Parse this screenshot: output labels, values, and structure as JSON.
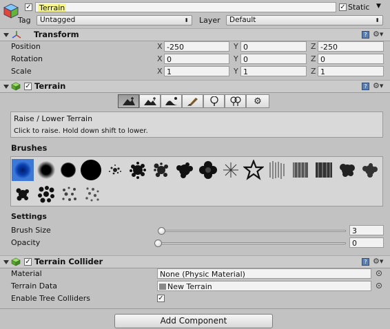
{
  "object": {
    "name": "Terrain",
    "active_checked": true,
    "static_label": "Static",
    "static_checked": true,
    "tag_label": "Tag",
    "tag_value": "Untagged",
    "layer_label": "Layer",
    "layer_value": "Default"
  },
  "transform": {
    "title": "Transform",
    "rows": [
      {
        "label": "Position",
        "x": "-250",
        "y": "0",
        "z": "-250"
      },
      {
        "label": "Rotation",
        "x": "0",
        "y": "0",
        "z": "0"
      },
      {
        "label": "Scale",
        "x": "1",
        "y": "1",
        "z": "1"
      }
    ],
    "axis_labels": [
      "X",
      "Y",
      "Z"
    ]
  },
  "terrain": {
    "title": "Terrain",
    "enabled": true,
    "tools": [
      {
        "icon": "raise-lower-terrain-icon",
        "active": true
      },
      {
        "icon": "paint-height-icon",
        "active": false
      },
      {
        "icon": "smooth-height-icon",
        "active": false
      },
      {
        "icon": "paint-texture-icon",
        "active": false
      },
      {
        "icon": "place-trees-icon",
        "active": false
      },
      {
        "icon": "paint-details-icon",
        "active": false
      },
      {
        "icon": "terrain-settings-icon",
        "active": false
      }
    ],
    "tool_name": "Raise / Lower Terrain",
    "tool_help": "Click to raise. Hold down shift to lower.",
    "brushes_label": "Brushes",
    "brush_count": 20,
    "selected_brush": 0,
    "settings_label": "Settings",
    "brush_size_label": "Brush Size",
    "brush_size_value": "3",
    "brush_size_fraction": 0.01,
    "opacity_label": "Opacity",
    "opacity_value": "0",
    "opacity_fraction": 0.0
  },
  "collider": {
    "title": "Terrain Collider",
    "enabled": true,
    "material_label": "Material",
    "material_value": "None (Physic Material)",
    "terrain_data_label": "Terrain Data",
    "terrain_data_value": "New Terrain",
    "tree_colliders_label": "Enable Tree Colliders",
    "tree_colliders_checked": true
  },
  "add_component_label": "Add Component",
  "colors": {
    "panel": "#c2c2c2",
    "header": "#cbcbcb",
    "highlight": "#f6f68a",
    "selected_brush_bg": "#3b78d8"
  }
}
